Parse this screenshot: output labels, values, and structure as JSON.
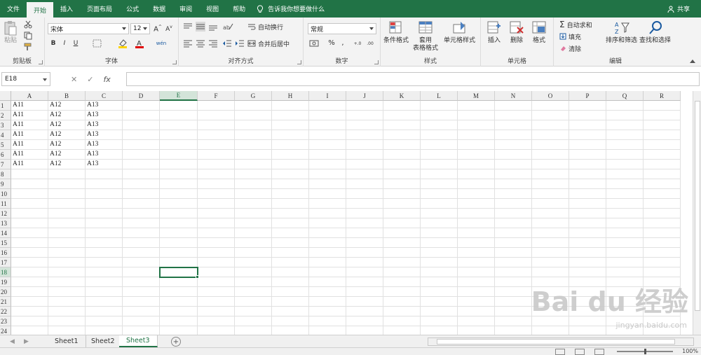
{
  "ribbon_tabs": [
    "文件",
    "开始",
    "插入",
    "页面布局",
    "公式",
    "数据",
    "审阅",
    "视图",
    "帮助"
  ],
  "active_tab_index": 1,
  "tell_me": "告诉我你想要做什么",
  "share": "共享",
  "groups": {
    "clipboard": {
      "label": "剪贴板",
      "paste": "粘贴"
    },
    "font": {
      "label": "字体",
      "font_name": "宋体",
      "font_size": "12"
    },
    "alignment": {
      "label": "对齐方式",
      "wrap": "自动换行",
      "merge": "合并后居中"
    },
    "number": {
      "label": "数字",
      "format": "常规"
    },
    "styles": {
      "label": "样式",
      "conditional": "条件格式",
      "table": "套用",
      "table2": "表格格式",
      "cell_styles": "单元格样式"
    },
    "cells": {
      "label": "单元格",
      "insert": "插入",
      "delete": "删除",
      "format": "格式"
    },
    "editing": {
      "label": "编辑",
      "autosum": "自动求和",
      "fill": "填充",
      "clear": "清除",
      "sort": "排序和筛选",
      "find": "查找和选择"
    }
  },
  "name_box": "E18",
  "fx": "fx",
  "columns": [
    "A",
    "B",
    "C",
    "D",
    "E",
    "F",
    "G",
    "H",
    "I",
    "J",
    "K",
    "L",
    "M",
    "N",
    "O",
    "P",
    "Q",
    "R"
  ],
  "rows": [
    "1",
    "2",
    "3",
    "4",
    "5",
    "6",
    "7",
    "8",
    "9",
    "10",
    "11",
    "12",
    "13",
    "14",
    "15",
    "16",
    "17",
    "18",
    "19",
    "20",
    "21",
    "22",
    "23",
    "24"
  ],
  "cells": [
    [
      "A11",
      "A12",
      "A13"
    ],
    [
      "A11",
      "A12",
      "A13"
    ],
    [
      "A11",
      "A12",
      "A13"
    ],
    [
      "A11",
      "A12",
      "A13"
    ],
    [
      "A11",
      "A12",
      "A13"
    ],
    [
      "A11",
      "A12",
      "A13"
    ],
    [
      "A11",
      "A12",
      "A13"
    ]
  ],
  "selected_col": "E",
  "selected_row": "18",
  "sheets": [
    "Sheet1",
    "Sheet2",
    "Sheet3"
  ],
  "active_sheet": "Sheet3",
  "zoom": "100%",
  "watermark": "Bai du 经验",
  "watermark_sub": "jingyan.baidu.com",
  "accent_color": "#217346"
}
